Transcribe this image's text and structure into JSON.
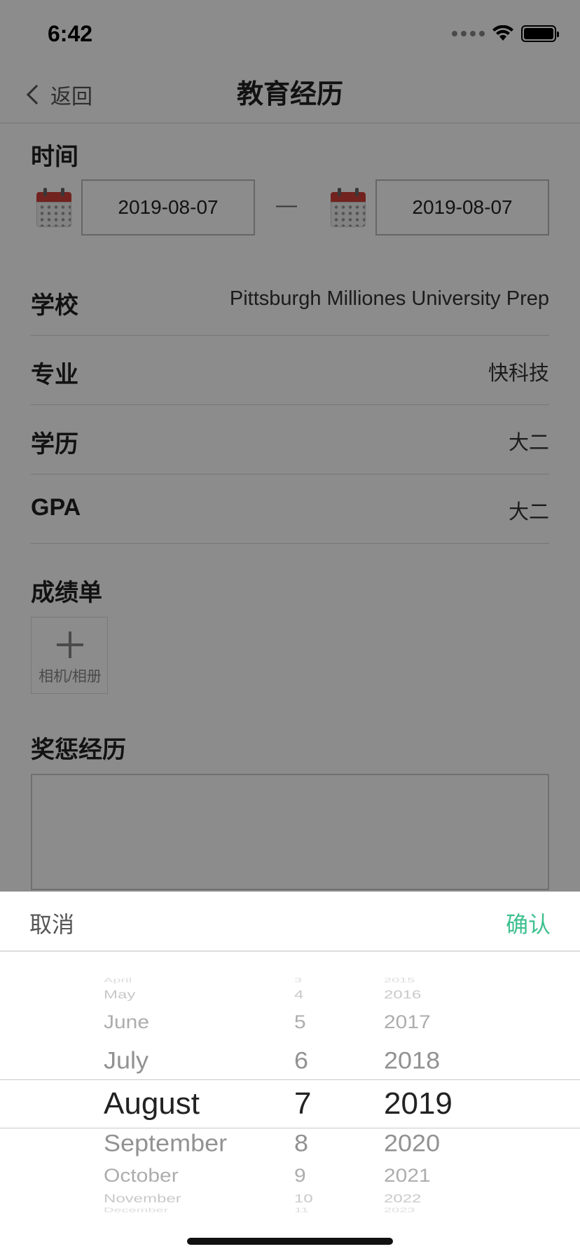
{
  "status": {
    "time": "6:42"
  },
  "nav": {
    "back_label": "返回",
    "title": "教育经历"
  },
  "time_section": {
    "label": "时间",
    "start_date": "2019-08-07",
    "separator": "—",
    "end_date": "2019-08-07"
  },
  "rows": [
    {
      "label": "学校",
      "value": "Pittsburgh Milliones University Prep"
    },
    {
      "label": "专业",
      "value": "快科技"
    },
    {
      "label": "学历",
      "value": "大二"
    },
    {
      "label": "GPA",
      "value": "大二"
    }
  ],
  "transcript": {
    "label": "成绩单",
    "upload_label": "相机/相册"
  },
  "awards": {
    "label": "奖惩经历",
    "value": ""
  },
  "picker": {
    "cancel_label": "取消",
    "confirm_label": "确认",
    "accent_color": "#3ec08f",
    "months": [
      "April",
      "May",
      "June",
      "July",
      "August",
      "September",
      "October",
      "November",
      "December"
    ],
    "days": [
      "3",
      "4",
      "5",
      "6",
      "7",
      "8",
      "9",
      "10",
      "11"
    ],
    "years": [
      "2015",
      "2016",
      "2017",
      "2018",
      "2019",
      "2020",
      "2021",
      "2022",
      "2023"
    ],
    "selected": {
      "month": "August",
      "day": "7",
      "year": "2019"
    }
  }
}
